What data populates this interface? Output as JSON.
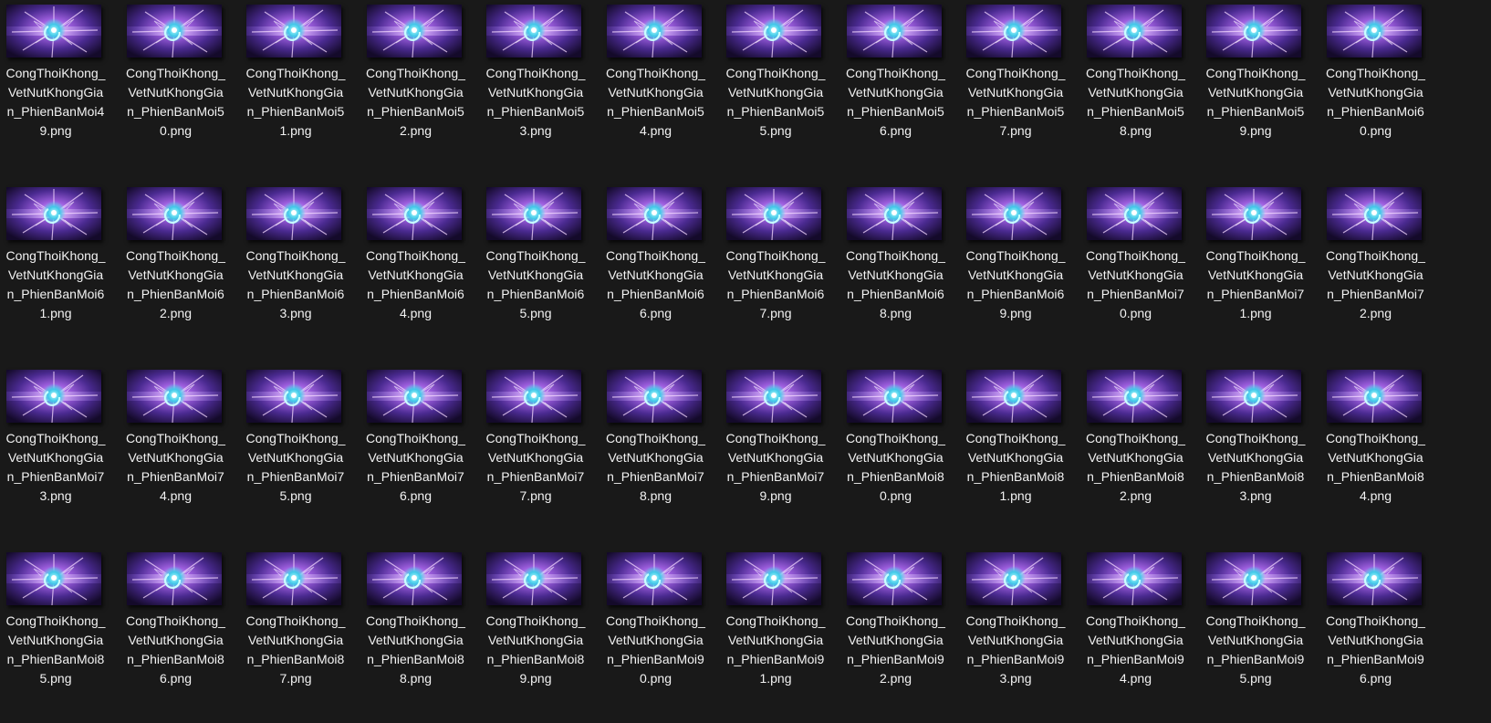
{
  "window": {
    "background": "#191919",
    "view": "large-icons"
  },
  "thumbnail_icon": "image-thumbnail-purple-explosion",
  "files": [
    {
      "name": "CongThoiKhong_VetNutKhongGian_PhienBanMoi49.png",
      "lines": [
        "CongThoiKhong_",
        "VetNutKhongGia",
        "n_PhienBanMoi4",
        "9.png"
      ]
    },
    {
      "name": "CongThoiKhong_VetNutKhongGian_PhienBanMoi50.png",
      "lines": [
        "CongThoiKhong_",
        "VetNutKhongGia",
        "n_PhienBanMoi5",
        "0.png"
      ]
    },
    {
      "name": "CongThoiKhong_VetNutKhongGian_PhienBanMoi51.png",
      "lines": [
        "CongThoiKhong_",
        "VetNutKhongGia",
        "n_PhienBanMoi5",
        "1.png"
      ]
    },
    {
      "name": "CongThoiKhong_VetNutKhongGian_PhienBanMoi52.png",
      "lines": [
        "CongThoiKhong_",
        "VetNutKhongGia",
        "n_PhienBanMoi5",
        "2.png"
      ]
    },
    {
      "name": "CongThoiKhong_VetNutKhongGian_PhienBanMoi53.png",
      "lines": [
        "CongThoiKhong_",
        "VetNutKhongGia",
        "n_PhienBanMoi5",
        "3.png"
      ]
    },
    {
      "name": "CongThoiKhong_VetNutKhongGian_PhienBanMoi54.png",
      "lines": [
        "CongThoiKhong_",
        "VetNutKhongGia",
        "n_PhienBanMoi5",
        "4.png"
      ]
    },
    {
      "name": "CongThoiKhong_VetNutKhongGian_PhienBanMoi55.png",
      "lines": [
        "CongThoiKhong_",
        "VetNutKhongGia",
        "n_PhienBanMoi5",
        "5.png"
      ]
    },
    {
      "name": "CongThoiKhong_VetNutKhongGian_PhienBanMoi56.png",
      "lines": [
        "CongThoiKhong_",
        "VetNutKhongGia",
        "n_PhienBanMoi5",
        "6.png"
      ]
    },
    {
      "name": "CongThoiKhong_VetNutKhongGian_PhienBanMoi57.png",
      "lines": [
        "CongThoiKhong_",
        "VetNutKhongGia",
        "n_PhienBanMoi5",
        "7.png"
      ]
    },
    {
      "name": "CongThoiKhong_VetNutKhongGian_PhienBanMoi58.png",
      "lines": [
        "CongThoiKhong_",
        "VetNutKhongGia",
        "n_PhienBanMoi5",
        "8.png"
      ]
    },
    {
      "name": "CongThoiKhong_VetNutKhongGian_PhienBanMoi59.png",
      "lines": [
        "CongThoiKhong_",
        "VetNutKhongGia",
        "n_PhienBanMoi5",
        "9.png"
      ]
    },
    {
      "name": "CongThoiKhong_VetNutKhongGian_PhienBanMoi60.png",
      "lines": [
        "CongThoiKhong_",
        "VetNutKhongGia",
        "n_PhienBanMoi6",
        "0.png"
      ]
    },
    {
      "name": "CongThoiKhong_VetNutKhongGian_PhienBanMoi61.png",
      "lines": [
        "CongThoiKhong_",
        "VetNutKhongGia",
        "n_PhienBanMoi6",
        "1.png"
      ]
    },
    {
      "name": "CongThoiKhong_VetNutKhongGian_PhienBanMoi62.png",
      "lines": [
        "CongThoiKhong_",
        "VetNutKhongGia",
        "n_PhienBanMoi6",
        "2.png"
      ]
    },
    {
      "name": "CongThoiKhong_VetNutKhongGian_PhienBanMoi63.png",
      "lines": [
        "CongThoiKhong_",
        "VetNutKhongGia",
        "n_PhienBanMoi6",
        "3.png"
      ]
    },
    {
      "name": "CongThoiKhong_VetNutKhongGian_PhienBanMoi64.png",
      "lines": [
        "CongThoiKhong_",
        "VetNutKhongGia",
        "n_PhienBanMoi6",
        "4.png"
      ]
    },
    {
      "name": "CongThoiKhong_VetNutKhongGian_PhienBanMoi65.png",
      "lines": [
        "CongThoiKhong_",
        "VetNutKhongGia",
        "n_PhienBanMoi6",
        "5.png"
      ]
    },
    {
      "name": "CongThoiKhong_VetNutKhongGian_PhienBanMoi66.png",
      "lines": [
        "CongThoiKhong_",
        "VetNutKhongGia",
        "n_PhienBanMoi6",
        "6.png"
      ]
    },
    {
      "name": "CongThoiKhong_VetNutKhongGian_PhienBanMoi67.png",
      "lines": [
        "CongThoiKhong_",
        "VetNutKhongGia",
        "n_PhienBanMoi6",
        "7.png"
      ]
    },
    {
      "name": "CongThoiKhong_VetNutKhongGian_PhienBanMoi68.png",
      "lines": [
        "CongThoiKhong_",
        "VetNutKhongGia",
        "n_PhienBanMoi6",
        "8.png"
      ]
    },
    {
      "name": "CongThoiKhong_VetNutKhongGian_PhienBanMoi69.png",
      "lines": [
        "CongThoiKhong_",
        "VetNutKhongGia",
        "n_PhienBanMoi6",
        "9.png"
      ]
    },
    {
      "name": "CongThoiKhong_VetNutKhongGian_PhienBanMoi70.png",
      "lines": [
        "CongThoiKhong_",
        "VetNutKhongGia",
        "n_PhienBanMoi7",
        "0.png"
      ]
    },
    {
      "name": "CongThoiKhong_VetNutKhongGian_PhienBanMoi71.png",
      "lines": [
        "CongThoiKhong_",
        "VetNutKhongGia",
        "n_PhienBanMoi7",
        "1.png"
      ]
    },
    {
      "name": "CongThoiKhong_VetNutKhongGian_PhienBanMoi72.png",
      "lines": [
        "CongThoiKhong_",
        "VetNutKhongGia",
        "n_PhienBanMoi7",
        "2.png"
      ]
    },
    {
      "name": "CongThoiKhong_VetNutKhongGian_PhienBanMoi73.png",
      "lines": [
        "CongThoiKhong_",
        "VetNutKhongGia",
        "n_PhienBanMoi7",
        "3.png"
      ]
    },
    {
      "name": "CongThoiKhong_VetNutKhongGian_PhienBanMoi74.png",
      "lines": [
        "CongThoiKhong_",
        "VetNutKhongGia",
        "n_PhienBanMoi7",
        "4.png"
      ]
    },
    {
      "name": "CongThoiKhong_VetNutKhongGian_PhienBanMoi75.png",
      "lines": [
        "CongThoiKhong_",
        "VetNutKhongGia",
        "n_PhienBanMoi7",
        "5.png"
      ]
    },
    {
      "name": "CongThoiKhong_VetNutKhongGian_PhienBanMoi76.png",
      "lines": [
        "CongThoiKhong_",
        "VetNutKhongGia",
        "n_PhienBanMoi7",
        "6.png"
      ]
    },
    {
      "name": "CongThoiKhong_VetNutKhongGian_PhienBanMoi77.png",
      "lines": [
        "CongThoiKhong_",
        "VetNutKhongGia",
        "n_PhienBanMoi7",
        "7.png"
      ]
    },
    {
      "name": "CongThoiKhong_VetNutKhongGian_PhienBanMoi78.png",
      "lines": [
        "CongThoiKhong_",
        "VetNutKhongGia",
        "n_PhienBanMoi7",
        "8.png"
      ]
    },
    {
      "name": "CongThoiKhong_VetNutKhongGian_PhienBanMoi79.png",
      "lines": [
        "CongThoiKhong_",
        "VetNutKhongGia",
        "n_PhienBanMoi7",
        "9.png"
      ]
    },
    {
      "name": "CongThoiKhong_VetNutKhongGian_PhienBanMoi80.png",
      "lines": [
        "CongThoiKhong_",
        "VetNutKhongGia",
        "n_PhienBanMoi8",
        "0.png"
      ]
    },
    {
      "name": "CongThoiKhong_VetNutKhongGian_PhienBanMoi81.png",
      "lines": [
        "CongThoiKhong_",
        "VetNutKhongGia",
        "n_PhienBanMoi8",
        "1.png"
      ]
    },
    {
      "name": "CongThoiKhong_VetNutKhongGian_PhienBanMoi82.png",
      "lines": [
        "CongThoiKhong_",
        "VetNutKhongGia",
        "n_PhienBanMoi8",
        "2.png"
      ]
    },
    {
      "name": "CongThoiKhong_VetNutKhongGian_PhienBanMoi83.png",
      "lines": [
        "CongThoiKhong_",
        "VetNutKhongGia",
        "n_PhienBanMoi8",
        "3.png"
      ]
    },
    {
      "name": "CongThoiKhong_VetNutKhongGian_PhienBanMoi84.png",
      "lines": [
        "CongThoiKhong_",
        "VetNutKhongGia",
        "n_PhienBanMoi8",
        "4.png"
      ]
    },
    {
      "name": "CongThoiKhong_VetNutKhongGian_PhienBanMoi85.png",
      "lines": [
        "CongThoiKhong_",
        "VetNutKhongGia",
        "n_PhienBanMoi8",
        "5.png"
      ]
    },
    {
      "name": "CongThoiKhong_VetNutKhongGian_PhienBanMoi86.png",
      "lines": [
        "CongThoiKhong_",
        "VetNutKhongGia",
        "n_PhienBanMoi8",
        "6.png"
      ]
    },
    {
      "name": "CongThoiKhong_VetNutKhongGian_PhienBanMoi87.png",
      "lines": [
        "CongThoiKhong_",
        "VetNutKhongGia",
        "n_PhienBanMoi8",
        "7.png"
      ]
    },
    {
      "name": "CongThoiKhong_VetNutKhongGian_PhienBanMoi88.png",
      "lines": [
        "CongThoiKhong_",
        "VetNutKhongGia",
        "n_PhienBanMoi8",
        "8.png"
      ]
    },
    {
      "name": "CongThoiKhong_VetNutKhongGian_PhienBanMoi89.png",
      "lines": [
        "CongThoiKhong_",
        "VetNutKhongGia",
        "n_PhienBanMoi8",
        "9.png"
      ]
    },
    {
      "name": "CongThoiKhong_VetNutKhongGian_PhienBanMoi90.png",
      "lines": [
        "CongThoiKhong_",
        "VetNutKhongGia",
        "n_PhienBanMoi9",
        "0.png"
      ]
    },
    {
      "name": "CongThoiKhong_VetNutKhongGian_PhienBanMoi91.png",
      "lines": [
        "CongThoiKhong_",
        "VetNutKhongGia",
        "n_PhienBanMoi9",
        "1.png"
      ]
    },
    {
      "name": "CongThoiKhong_VetNutKhongGian_PhienBanMoi92.png",
      "lines": [
        "CongThoiKhong_",
        "VetNutKhongGia",
        "n_PhienBanMoi9",
        "2.png"
      ]
    },
    {
      "name": "CongThoiKhong_VetNutKhongGian_PhienBanMoi93.png",
      "lines": [
        "CongThoiKhong_",
        "VetNutKhongGia",
        "n_PhienBanMoi9",
        "3.png"
      ]
    },
    {
      "name": "CongThoiKhong_VetNutKhongGian_PhienBanMoi94.png",
      "lines": [
        "CongThoiKhong_",
        "VetNutKhongGia",
        "n_PhienBanMoi9",
        "4.png"
      ]
    },
    {
      "name": "CongThoiKhong_VetNutKhongGian_PhienBanMoi95.png",
      "lines": [
        "CongThoiKhong_",
        "VetNutKhongGia",
        "n_PhienBanMoi9",
        "5.png"
      ]
    },
    {
      "name": "CongThoiKhong_VetNutKhongGian_PhienBanMoi96.png",
      "lines": [
        "CongThoiKhong_",
        "VetNutKhongGia",
        "n_PhienBanMoi9",
        "6.png"
      ]
    }
  ]
}
